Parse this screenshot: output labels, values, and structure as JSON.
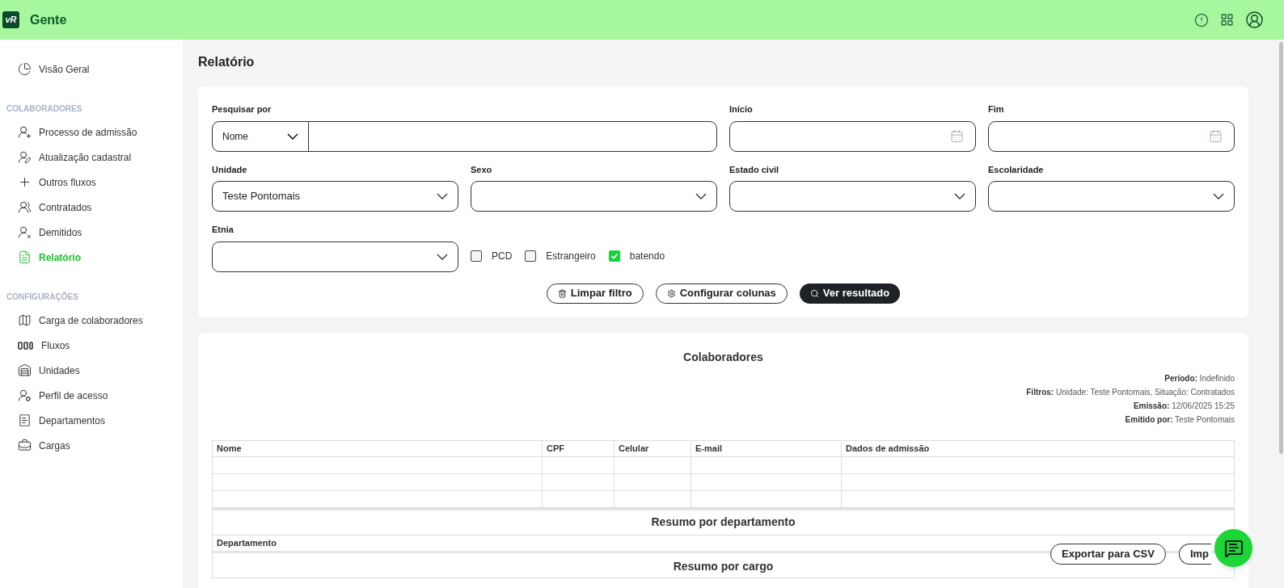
{
  "header": {
    "logo": "vR",
    "app_name": "Gente"
  },
  "sidebar": {
    "sections": [
      {
        "items": [
          {
            "label": "Visão Geral",
            "selected": false
          }
        ]
      },
      {
        "title": "COLABORADORES",
        "items": [
          {
            "label": "Processo de admissão",
            "selected": false
          },
          {
            "label": "Atualização cadastral",
            "selected": false
          },
          {
            "label": "Outros fluxos",
            "selected": false
          },
          {
            "label": "Contratados",
            "selected": false
          },
          {
            "label": "Demitidos",
            "selected": false
          },
          {
            "label": "Relatório",
            "selected": true
          }
        ]
      },
      {
        "title": "CONFIGURAÇÕES",
        "items": [
          {
            "label": "Carga de colaboradores",
            "selected": false
          },
          {
            "label": "Fluxos",
            "selected": false
          },
          {
            "label": "Unidades",
            "selected": false
          },
          {
            "label": "Perfil de acesso",
            "selected": false
          },
          {
            "label": "Departamentos",
            "selected": false
          },
          {
            "label": "Cargas",
            "selected": false
          }
        ]
      }
    ]
  },
  "page_title": "Relatório",
  "filters": {
    "search": {
      "label": "Pesquisar por",
      "type_value": "Nome"
    },
    "start": {
      "label": "Início"
    },
    "end": {
      "label": "Fim"
    },
    "selects": [
      {
        "label": "Unidade",
        "value": "Teste Pontomais"
      },
      {
        "label": "Sexo"
      },
      {
        "label": "Estado civil"
      },
      {
        "label": "Escolaridade"
      }
    ],
    "ethnicity": {
      "label": "Etnia"
    },
    "checkboxes": [
      {
        "label": "PCD",
        "checked": false
      },
      {
        "label": "Estrangeiro",
        "checked": false
      },
      {
        "label": "batendo",
        "checked": true
      }
    ],
    "buttons": [
      {
        "label": "Limpar filtro",
        "kind": "clear"
      },
      {
        "label": "Configurar colunas",
        "kind": "config"
      },
      {
        "label": "Ver resultado",
        "kind": "primary"
      }
    ]
  },
  "report": {
    "title": "Colaboradores",
    "meta": [
      "**Período:** Indefinido",
      "**Filtros:** Unidade: Teste Pontomais, Situação: Contratados",
      "**Emissão:** 12/06/2025 15:25",
      "**Emitido por:** Teste Pontomais"
    ],
    "table": {
      "columns": [
        "Nome",
        "CPF",
        "Celular",
        "E-mail",
        "Dados de admissão"
      ]
    },
    "department_summary": {
      "title": "Resumo por departamento",
      "columns": [
        "Departamento"
      ]
    },
    "role_summary": {
      "title": "Resumo por cargo"
    }
  },
  "actions": [
    "Exportar para CSV",
    "Imp"
  ]
}
